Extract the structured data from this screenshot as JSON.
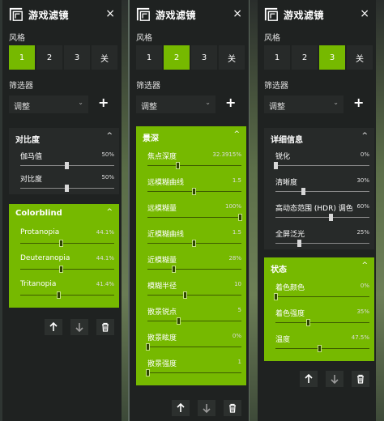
{
  "app": {
    "title": "游戏滤镜",
    "close": "×"
  },
  "labels": {
    "style": "风格",
    "filter": "筛选器"
  },
  "style_buttons": [
    "1",
    "2",
    "3",
    "关"
  ],
  "filter_dropdown": {
    "value": "调整"
  },
  "add": "+",
  "collapse_symbol": "^",
  "panels": [
    {
      "active_style": 0,
      "sections": [
        {
          "title": "对比度",
          "variant": "dark",
          "sliders": [
            {
              "name": "伽马值",
              "value": "50%",
              "pos": 0.5
            },
            {
              "name": "对比度",
              "value": "50%",
              "pos": 0.5
            }
          ]
        },
        {
          "title": "Colorblind",
          "variant": "green",
          "sliders": [
            {
              "name": "Protanopia",
              "value": "44.1%",
              "pos": 0.441
            },
            {
              "name": "Deuteranopia",
              "value": "44.1%",
              "pos": 0.441
            },
            {
              "name": "Tritanopia",
              "value": "41.4%",
              "pos": 0.414
            }
          ]
        }
      ]
    },
    {
      "active_style": 1,
      "sections": [
        {
          "title": "景深",
          "variant": "green",
          "sliders": [
            {
              "name": "焦点深度",
              "value": "32.3915%",
              "pos": 0.324
            },
            {
              "name": "远模糊曲线",
              "value": "1.5",
              "pos": 0.5
            },
            {
              "name": "远模糊量",
              "value": "100%",
              "pos": 1.0
            },
            {
              "name": "近模糊曲线",
              "value": "1.5",
              "pos": 0.5
            },
            {
              "name": "近模糊量",
              "value": "28%",
              "pos": 0.28
            },
            {
              "name": "模糊半径",
              "value": "10",
              "pos": 0.4
            },
            {
              "name": "散景锐点",
              "value": "5",
              "pos": 0.33
            },
            {
              "name": "散景眩度",
              "value": "0%",
              "pos": 0.0
            },
            {
              "name": "散景强度",
              "value": "1",
              "pos": 0.0
            }
          ]
        }
      ]
    },
    {
      "active_style": 2,
      "sections": [
        {
          "title": "详细信息",
          "variant": "dark",
          "sliders": [
            {
              "name": "锐化",
              "value": "0%",
              "pos": 0.0
            },
            {
              "name": "清晰度",
              "value": "30%",
              "pos": 0.3
            },
            {
              "name": "高动态范围 (HDR) 调色",
              "value": "60%",
              "pos": 0.6
            },
            {
              "name": "全屏泛光",
              "value": "25%",
              "pos": 0.25
            }
          ]
        },
        {
          "title": "状态",
          "variant": "green",
          "sliders": [
            {
              "name": "着色颜色",
              "value": "0%",
              "pos": 0.0
            },
            {
              "name": "着色强度",
              "value": "35%",
              "pos": 0.35
            },
            {
              "name": "温度",
              "value": "47.5%",
              "pos": 0.475
            }
          ]
        }
      ]
    }
  ]
}
